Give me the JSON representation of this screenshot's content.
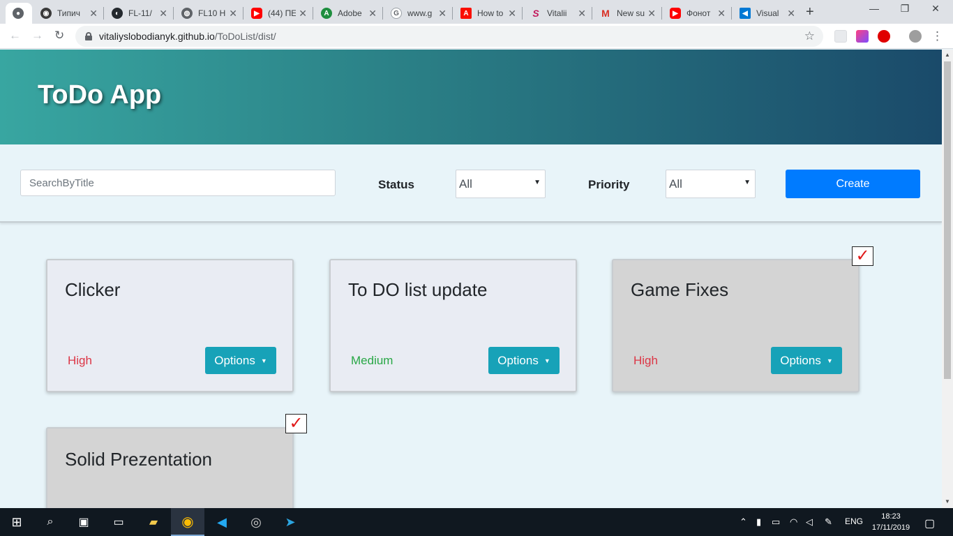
{
  "browser": {
    "tabs": [
      {
        "label": "",
        "icon": "chrome-icon",
        "active": true
      },
      {
        "label": "Типич",
        "icon": "globe-icon"
      },
      {
        "label": "FL-11/",
        "icon": "github-icon"
      },
      {
        "label": "FL10 H",
        "icon": "globe-icon"
      },
      {
        "label": "(44) ПЕ",
        "icon": "youtube-icon"
      },
      {
        "label": "Adobe",
        "icon": "adobe-ext-icon"
      },
      {
        "label": "www.g",
        "icon": "google-icon"
      },
      {
        "label": "How to",
        "icon": "adobe-icon"
      },
      {
        "label": "Vitalii",
        "icon": "s-icon"
      },
      {
        "label": "New su",
        "icon": "gmail-icon"
      },
      {
        "label": "Фонот",
        "icon": "youtube-icon"
      },
      {
        "label": "Visual",
        "icon": "vscode-icon"
      }
    ],
    "url_host": "vitaliyslobodianyk.github.io",
    "url_path": "/ToDoList/dist/"
  },
  "app": {
    "title": "ToDo App",
    "search_placeholder": "SearchByTitle",
    "status_label": "Status",
    "status_value": "All",
    "priority_label": "Priority",
    "priority_value": "All",
    "create_label": "Create",
    "options_label": "Options",
    "check_mark": "✓"
  },
  "cards": [
    {
      "title": "Clicker",
      "priority": "High",
      "done": false
    },
    {
      "title": "To DO list update",
      "priority": "Medium",
      "done": false
    },
    {
      "title": "Game Fixes",
      "priority": "High",
      "done": true
    },
    {
      "title": "Solid Prezentation",
      "priority": "",
      "done": true
    }
  ],
  "taskbar": {
    "language": "ENG",
    "time": "18:23",
    "date": "17/11/2019"
  },
  "colors": {
    "header_start": "#38a6a1",
    "header_end": "#1a4a6a",
    "create_button": "#007bff",
    "options_button": "#17a2b8",
    "priority_high": "#dc3545",
    "priority_medium": "#28a745",
    "card_done_bg": "#d4d4d4",
    "card_bg": "#e9ecf3"
  }
}
